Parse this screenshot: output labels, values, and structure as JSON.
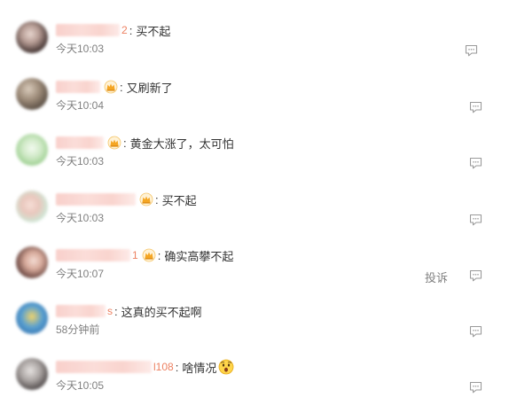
{
  "comments": [
    {
      "username_tail": "2",
      "text": "买不起",
      "time": "今天10:03",
      "has_badge": false
    },
    {
      "username_tail": "",
      "text": "又刷新了",
      "time": "今天10:04",
      "has_badge": true
    },
    {
      "username_tail": "",
      "text": "黄金大涨了，太可怕",
      "time": "今天10:03",
      "has_badge": true
    },
    {
      "username_tail": "",
      "text": "买不起",
      "time": "今天10:03",
      "has_badge": true
    },
    {
      "username_tail": "1",
      "text": "确实高攀不起",
      "time": "今天10:07",
      "has_badge": true,
      "report_label": "投诉"
    },
    {
      "username_tail": "s",
      "text": "这真的买不起啊",
      "time": "58分钟前",
      "has_badge": false
    },
    {
      "username_tail": "l108",
      "text": "啥情况",
      "time": "今天10:05",
      "has_badge": false,
      "emoji": "surprised-face"
    }
  ],
  "icons": {
    "badge": "crown-badge-icon",
    "reply": "comment-reply-icon"
  },
  "colors": {
    "text": "#333333",
    "meta": "#808080",
    "username": "#eb7350",
    "badge": "#f5a623",
    "icon": "#9a9a9a"
  }
}
